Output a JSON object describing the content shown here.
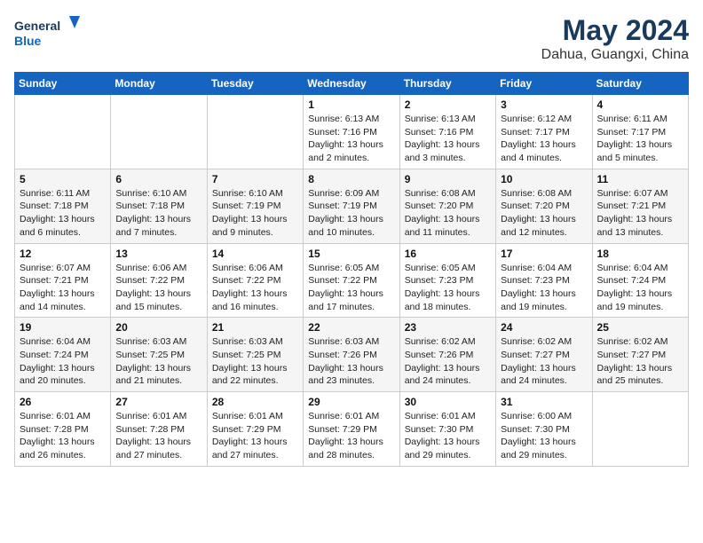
{
  "header": {
    "logo_line1": "General",
    "logo_line2": "Blue",
    "title": "May 2024",
    "subtitle": "Dahua, Guangxi, China"
  },
  "days_of_week": [
    "Sunday",
    "Monday",
    "Tuesday",
    "Wednesday",
    "Thursday",
    "Friday",
    "Saturday"
  ],
  "weeks": [
    [
      {
        "day": "",
        "info": ""
      },
      {
        "day": "",
        "info": ""
      },
      {
        "day": "",
        "info": ""
      },
      {
        "day": "1",
        "info": "Sunrise: 6:13 AM\nSunset: 7:16 PM\nDaylight: 13 hours\nand 2 minutes."
      },
      {
        "day": "2",
        "info": "Sunrise: 6:13 AM\nSunset: 7:16 PM\nDaylight: 13 hours\nand 3 minutes."
      },
      {
        "day": "3",
        "info": "Sunrise: 6:12 AM\nSunset: 7:17 PM\nDaylight: 13 hours\nand 4 minutes."
      },
      {
        "day": "4",
        "info": "Sunrise: 6:11 AM\nSunset: 7:17 PM\nDaylight: 13 hours\nand 5 minutes."
      }
    ],
    [
      {
        "day": "5",
        "info": "Sunrise: 6:11 AM\nSunset: 7:18 PM\nDaylight: 13 hours\nand 6 minutes."
      },
      {
        "day": "6",
        "info": "Sunrise: 6:10 AM\nSunset: 7:18 PM\nDaylight: 13 hours\nand 7 minutes."
      },
      {
        "day": "7",
        "info": "Sunrise: 6:10 AM\nSunset: 7:19 PM\nDaylight: 13 hours\nand 9 minutes."
      },
      {
        "day": "8",
        "info": "Sunrise: 6:09 AM\nSunset: 7:19 PM\nDaylight: 13 hours\nand 10 minutes."
      },
      {
        "day": "9",
        "info": "Sunrise: 6:08 AM\nSunset: 7:20 PM\nDaylight: 13 hours\nand 11 minutes."
      },
      {
        "day": "10",
        "info": "Sunrise: 6:08 AM\nSunset: 7:20 PM\nDaylight: 13 hours\nand 12 minutes."
      },
      {
        "day": "11",
        "info": "Sunrise: 6:07 AM\nSunset: 7:21 PM\nDaylight: 13 hours\nand 13 minutes."
      }
    ],
    [
      {
        "day": "12",
        "info": "Sunrise: 6:07 AM\nSunset: 7:21 PM\nDaylight: 13 hours\nand 14 minutes."
      },
      {
        "day": "13",
        "info": "Sunrise: 6:06 AM\nSunset: 7:22 PM\nDaylight: 13 hours\nand 15 minutes."
      },
      {
        "day": "14",
        "info": "Sunrise: 6:06 AM\nSunset: 7:22 PM\nDaylight: 13 hours\nand 16 minutes."
      },
      {
        "day": "15",
        "info": "Sunrise: 6:05 AM\nSunset: 7:22 PM\nDaylight: 13 hours\nand 17 minutes."
      },
      {
        "day": "16",
        "info": "Sunrise: 6:05 AM\nSunset: 7:23 PM\nDaylight: 13 hours\nand 18 minutes."
      },
      {
        "day": "17",
        "info": "Sunrise: 6:04 AM\nSunset: 7:23 PM\nDaylight: 13 hours\nand 19 minutes."
      },
      {
        "day": "18",
        "info": "Sunrise: 6:04 AM\nSunset: 7:24 PM\nDaylight: 13 hours\nand 19 minutes."
      }
    ],
    [
      {
        "day": "19",
        "info": "Sunrise: 6:04 AM\nSunset: 7:24 PM\nDaylight: 13 hours\nand 20 minutes."
      },
      {
        "day": "20",
        "info": "Sunrise: 6:03 AM\nSunset: 7:25 PM\nDaylight: 13 hours\nand 21 minutes."
      },
      {
        "day": "21",
        "info": "Sunrise: 6:03 AM\nSunset: 7:25 PM\nDaylight: 13 hours\nand 22 minutes."
      },
      {
        "day": "22",
        "info": "Sunrise: 6:03 AM\nSunset: 7:26 PM\nDaylight: 13 hours\nand 23 minutes."
      },
      {
        "day": "23",
        "info": "Sunrise: 6:02 AM\nSunset: 7:26 PM\nDaylight: 13 hours\nand 24 minutes."
      },
      {
        "day": "24",
        "info": "Sunrise: 6:02 AM\nSunset: 7:27 PM\nDaylight: 13 hours\nand 24 minutes."
      },
      {
        "day": "25",
        "info": "Sunrise: 6:02 AM\nSunset: 7:27 PM\nDaylight: 13 hours\nand 25 minutes."
      }
    ],
    [
      {
        "day": "26",
        "info": "Sunrise: 6:01 AM\nSunset: 7:28 PM\nDaylight: 13 hours\nand 26 minutes."
      },
      {
        "day": "27",
        "info": "Sunrise: 6:01 AM\nSunset: 7:28 PM\nDaylight: 13 hours\nand 27 minutes."
      },
      {
        "day": "28",
        "info": "Sunrise: 6:01 AM\nSunset: 7:29 PM\nDaylight: 13 hours\nand 27 minutes."
      },
      {
        "day": "29",
        "info": "Sunrise: 6:01 AM\nSunset: 7:29 PM\nDaylight: 13 hours\nand 28 minutes."
      },
      {
        "day": "30",
        "info": "Sunrise: 6:01 AM\nSunset: 7:30 PM\nDaylight: 13 hours\nand 29 minutes."
      },
      {
        "day": "31",
        "info": "Sunrise: 6:00 AM\nSunset: 7:30 PM\nDaylight: 13 hours\nand 29 minutes."
      },
      {
        "day": "",
        "info": ""
      }
    ]
  ]
}
